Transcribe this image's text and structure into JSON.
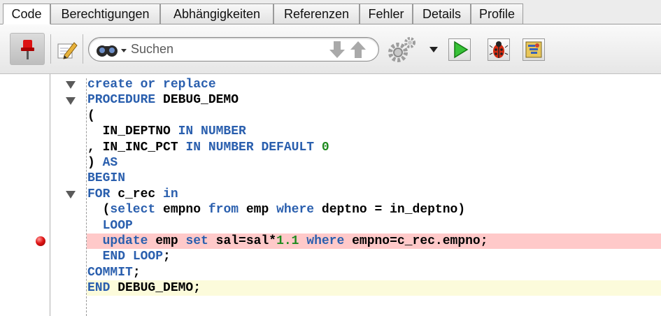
{
  "tabs": [
    {
      "label": "Code",
      "active": true
    },
    {
      "label": "Berechtigungen"
    },
    {
      "label": "Abhängigkeiten"
    },
    {
      "label": "Referenzen"
    },
    {
      "label": "Fehler"
    },
    {
      "label": "Details"
    },
    {
      "label": "Profile"
    }
  ],
  "toolbar": {
    "search_placeholder": "Suchen",
    "icons": [
      "pin-icon",
      "edit-icon",
      "binoculars-icon",
      "arrow-down-icon",
      "arrow-up-icon",
      "gear-icon",
      "run-icon",
      "debug-icon",
      "profile-icon"
    ]
  },
  "editor": {
    "breakpoint_line": 11,
    "current_line": 14,
    "folded_lines": [
      1,
      2,
      8
    ],
    "colors": {
      "keyword": "#2a5fae",
      "number": "#1e8a1e",
      "breakpoint_bg": "#ffc9c9",
      "current_bg": "#fcfbdb"
    },
    "lines": [
      [
        {
          "t": "create or replace",
          "k": true
        }
      ],
      [
        {
          "t": "PROCEDURE",
          "k": true
        },
        {
          "t": " DEBUG_DEMO"
        }
      ],
      [
        {
          "t": "("
        }
      ],
      [
        {
          "t": "  IN_DEPTNO "
        },
        {
          "t": "IN NUMBER",
          "k": true
        }
      ],
      [
        {
          "t": ", IN_INC_PCT "
        },
        {
          "t": "IN NUMBER DEFAULT",
          "k": true
        },
        {
          "t": " "
        },
        {
          "t": "0",
          "n": true
        }
      ],
      [
        {
          "t": ") "
        },
        {
          "t": "AS",
          "k": true
        }
      ],
      [
        {
          "t": "BEGIN",
          "k": true
        }
      ],
      [
        {
          "t": "FOR",
          "k": true
        },
        {
          "t": " c_rec "
        },
        {
          "t": "in",
          "k": true
        }
      ],
      [
        {
          "t": "  ("
        },
        {
          "t": "select",
          "k": true
        },
        {
          "t": " empno "
        },
        {
          "t": "from",
          "k": true
        },
        {
          "t": " emp "
        },
        {
          "t": "where",
          "k": true
        },
        {
          "t": " deptno = in_deptno)"
        }
      ],
      [
        {
          "t": "  "
        },
        {
          "t": "LOOP",
          "k": true
        }
      ],
      [
        {
          "t": "  "
        },
        {
          "t": "update",
          "k": true
        },
        {
          "t": " emp "
        },
        {
          "t": "set",
          "k": true
        },
        {
          "t": " sal=sal*"
        },
        {
          "t": "1.1",
          "n": true
        },
        {
          "t": " "
        },
        {
          "t": "where",
          "k": true
        },
        {
          "t": " empno=c_rec.empno;"
        }
      ],
      [
        {
          "t": "  "
        },
        {
          "t": "END LOOP",
          "k": true
        },
        {
          "t": ";"
        }
      ],
      [
        {
          "t": "COMMIT",
          "k": true
        },
        {
          "t": ";"
        }
      ],
      [
        {
          "t": "END",
          "k": true
        },
        {
          "t": " DEBUG_DEMO;"
        }
      ]
    ]
  }
}
